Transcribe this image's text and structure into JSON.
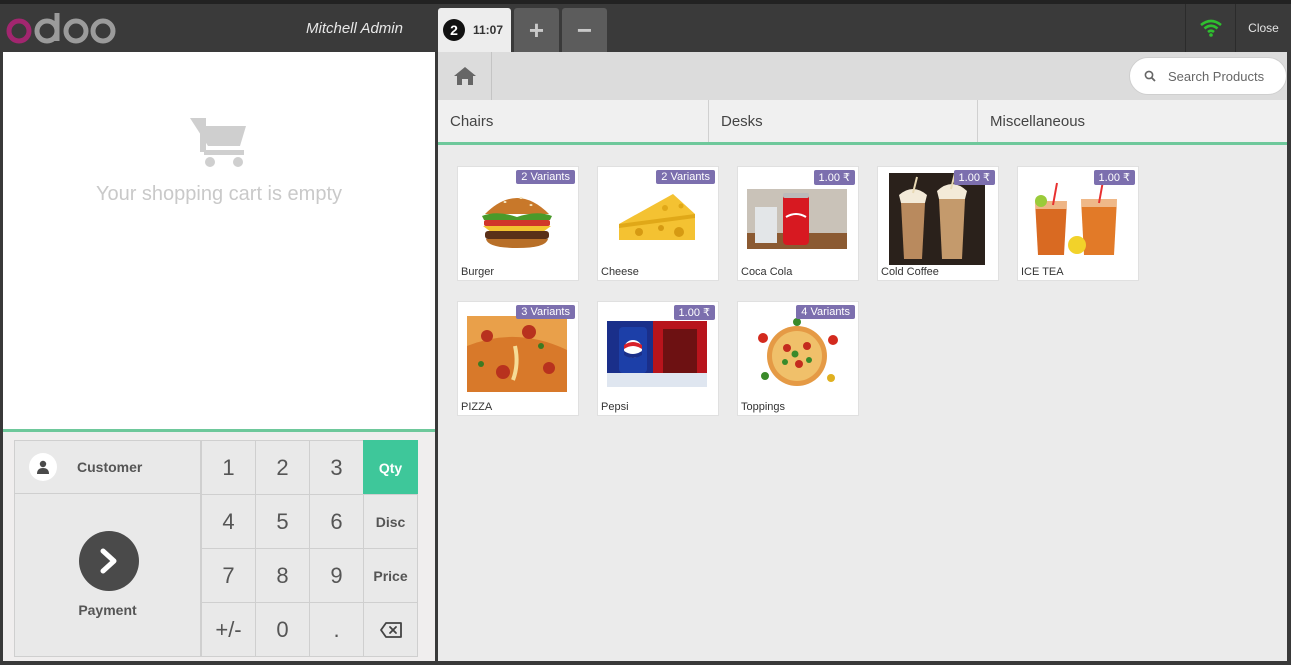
{
  "header": {
    "logo_text": "odoo",
    "cashier": "Mitchell Admin",
    "order_number": "2",
    "order_time": "11:07",
    "add_order_label": "+",
    "remove_order_label": "−",
    "close_label": "Close",
    "wifi_color": "#2fbf2f"
  },
  "cart": {
    "empty_text": "Your shopping cart is empty"
  },
  "controls": {
    "customer_label": "Customer",
    "payment_label": "Payment",
    "active_mode": "Qty",
    "keys": [
      "1",
      "2",
      "3",
      "Qty",
      "4",
      "5",
      "6",
      "Disc",
      "7",
      "8",
      "9",
      "Price",
      "+/-",
      "0",
      "."
    ]
  },
  "catalog": {
    "search_placeholder": "Search Products",
    "categories": [
      "Chairs",
      "Desks",
      "Miscellaneous"
    ],
    "products": [
      {
        "name": "Burger",
        "badge": "2 Variants",
        "icon": "burger-icon"
      },
      {
        "name": "Cheese",
        "badge": "2 Variants",
        "icon": "cheese-icon"
      },
      {
        "name": "Coca Cola",
        "badge": "1.00 ₹",
        "icon": "cola-can-icon"
      },
      {
        "name": "Cold Coffee",
        "badge": "1.00 ₹",
        "icon": "coffee-glass-icon"
      },
      {
        "name": "ICE TEA",
        "badge": "1.00 ₹",
        "icon": "ice-tea-icon"
      },
      {
        "name": "PIZZA",
        "badge": "3 Variants",
        "icon": "pizza-slice-icon"
      },
      {
        "name": "Pepsi",
        "badge": "1.00 ₹",
        "icon": "pepsi-can-icon"
      },
      {
        "name": "Toppings",
        "badge": "4 Variants",
        "icon": "pizza-icon"
      }
    ]
  },
  "colors": {
    "accent": "#3ec79a",
    "badge": "#7c6fae",
    "logo": "#9b9b9b",
    "logo_o": "#a2266f"
  }
}
